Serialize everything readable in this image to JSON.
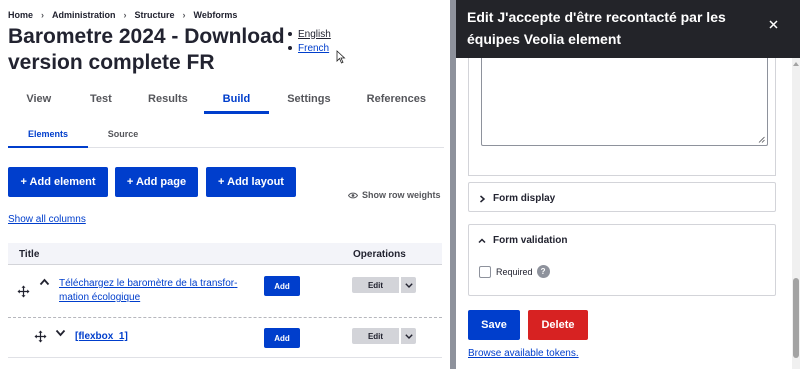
{
  "breadcrumb": [
    "Home",
    "Administration",
    "Structure",
    "Webforms"
  ],
  "breadcrumb_sep": "›",
  "page_title": "Barometre 2024 - Download version complete FR",
  "languages": [
    "English",
    "French"
  ],
  "primary_tabs": [
    {
      "label": "View",
      "active": false
    },
    {
      "label": "Test",
      "active": false
    },
    {
      "label": "Results",
      "active": false
    },
    {
      "label": "Build",
      "active": true
    },
    {
      "label": "Settings",
      "active": false
    },
    {
      "label": "References",
      "active": false
    }
  ],
  "secondary_tabs": [
    {
      "label": "Elements",
      "active": true
    },
    {
      "label": "Source",
      "active": false
    }
  ],
  "actions": {
    "add_element": "+ Add element",
    "add_page": "+ Add page",
    "add_layout": "+ Add layout",
    "row_weights": "Show row weights",
    "show_columns": "Show all columns"
  },
  "table": {
    "headers": {
      "title": "Title",
      "operations": "Operations"
    },
    "rows": [
      {
        "title": "Téléchargez le baromètre de la transfor­mation écologique",
        "add": "Add",
        "edit": "Edit"
      },
      {
        "title": "[flexbox_1]",
        "add": "Add",
        "edit": "Edit"
      }
    ]
  },
  "dialog": {
    "title": "Edit J'accepte d'être recontacté par les équipes Veolia element",
    "form_display": "Form display",
    "form_validation": "Form validation",
    "required_label": "Required",
    "help": "?",
    "save": "Save",
    "delete": "Delete",
    "browse_tokens": "Browse available tokens."
  },
  "colors": {
    "primary": "#003ecc",
    "danger": "#d72222",
    "dialog_header": "#232429"
  }
}
